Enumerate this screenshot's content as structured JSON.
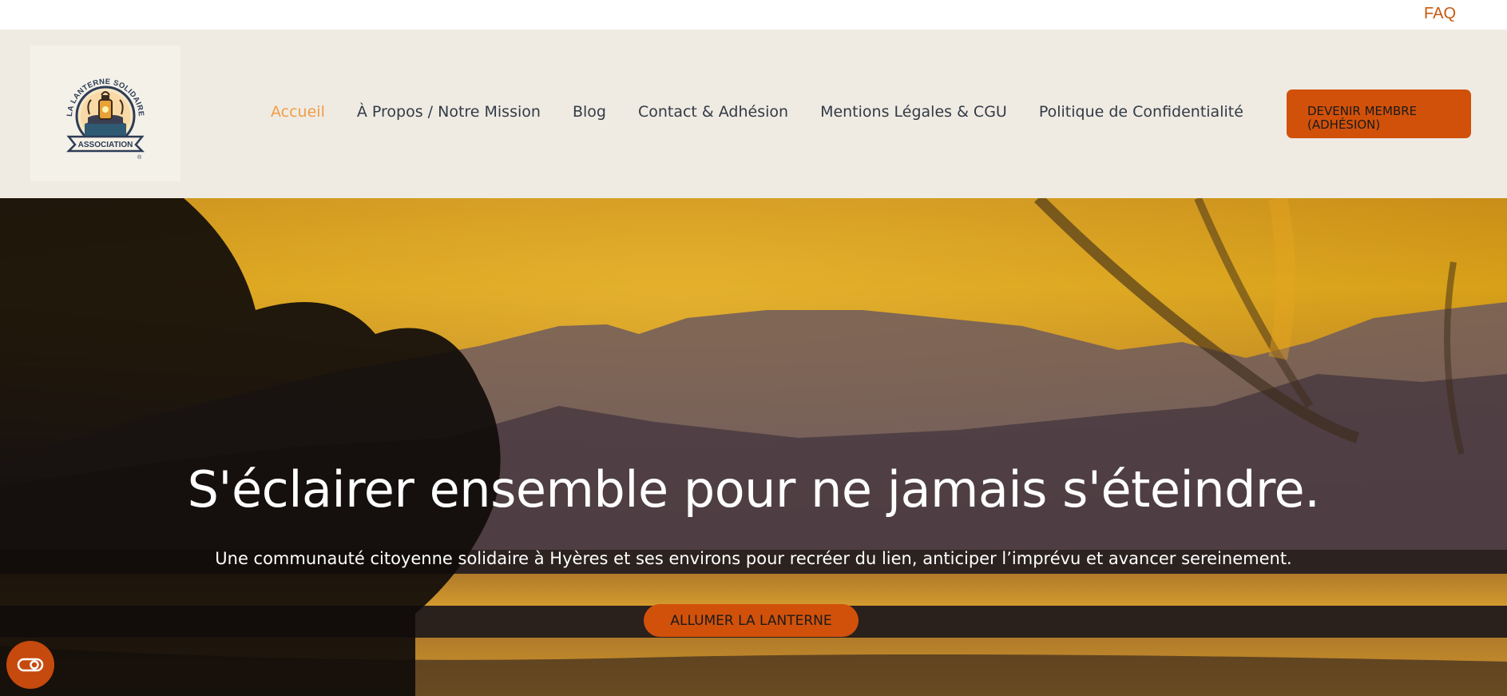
{
  "topbar": {
    "faq_label": "FAQ"
  },
  "header": {
    "logo": {
      "icon": "lantern-logo-icon",
      "arc_text": "LA LANTERNE SOLIDAIRE",
      "ribbon_text": "ASSOCIATION",
      "mark": "®"
    },
    "nav": [
      {
        "label": "Accueil",
        "active": true
      },
      {
        "label": "À Propos / Notre Mission"
      },
      {
        "label": "Blog"
      },
      {
        "label": "Contact & Adhésion"
      },
      {
        "label": "Mentions Légales & CGU"
      },
      {
        "label": "Politique de Confidentialité"
      }
    ],
    "member_button_label": "DEVENIR MEMBRE (ADHÉSION)"
  },
  "hero": {
    "title": "S'éclairer ensemble pour ne jamais s'éteindre.",
    "subtitle": "Une communauté citoyenne solidaire à Hyères et ses environs pour recréer du lien, anticiper l’imprévu et avancer sereinement.",
    "cta_label": "ALLUMER LA LANTERNE"
  },
  "accessibility": {
    "icon": "accessibility-toggle-icon"
  },
  "colors": {
    "accent": "#d1510a",
    "nav_active": "#ee9e45",
    "faq": "#c6590f",
    "header_bg": "#efebe3"
  }
}
